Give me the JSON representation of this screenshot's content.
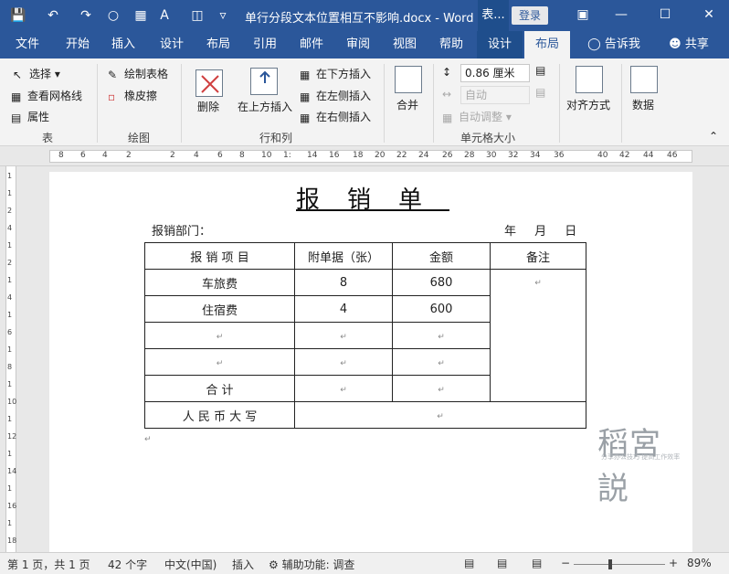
{
  "titlebar": {
    "doc_title": "单行分段文本位置相互不影响.docx - Word",
    "context_tab": "表...",
    "login": "登录"
  },
  "tabs": [
    {
      "label": "文件"
    },
    {
      "label": "开始"
    },
    {
      "label": "插入"
    },
    {
      "label": "设计"
    },
    {
      "label": "布局"
    },
    {
      "label": "引用"
    },
    {
      "label": "邮件"
    },
    {
      "label": "审阅"
    },
    {
      "label": "视图"
    },
    {
      "label": "帮助"
    },
    {
      "label": "设计"
    },
    {
      "label": "布局"
    },
    {
      "label": "告诉我"
    },
    {
      "label": "共享"
    }
  ],
  "ribbon": {
    "table_group": {
      "select": "选择",
      "gridlines": "查看网格线",
      "properties": "属性",
      "label": "表"
    },
    "draw_group": {
      "draw_table": "绘制表格",
      "eraser": "橡皮擦",
      "label": "绘图"
    },
    "rows_group": {
      "delete": "删除",
      "insert_above": "在上方插入",
      "insert_below": "在下方插入",
      "insert_left": "在左侧插入",
      "insert_right": "在右侧插入",
      "label": "行和列"
    },
    "merge_group": {
      "merge": "合并"
    },
    "cellsize_group": {
      "height": "0.86 厘米",
      "width": "自动",
      "autofit": "自动调整",
      "label": "单元格大小"
    },
    "align_group": {
      "align": "对齐方式"
    },
    "data_group": {
      "data": "数据"
    }
  },
  "ruler": {
    "numbers": [
      "8",
      "6",
      "4",
      "2",
      "2",
      "4",
      "6",
      "8",
      "10",
      "1:",
      "14",
      "16",
      "18",
      "20",
      "22",
      "24",
      "26",
      "28",
      "30",
      "32",
      "34",
      "36",
      "40",
      "42",
      "44",
      "46"
    ]
  },
  "vruler": {
    "numbers": [
      "1",
      "1",
      "2",
      "4",
      "1",
      "2",
      "1",
      "4",
      "1",
      "6",
      "1",
      "8",
      "1",
      "10",
      "1",
      "12",
      "1",
      "14",
      "1",
      "16",
      "1",
      "18"
    ]
  },
  "document": {
    "title": "报销单",
    "dept_label": "报销部门：",
    "date_label": "年 月 日",
    "table": {
      "headers": [
        "报 销 项 目",
        "附单据（张）",
        "金额",
        "备注"
      ],
      "rows": [
        [
          "车旅费",
          "8",
          "680"
        ],
        [
          "住宿费",
          "4",
          "600"
        ],
        [
          "",
          "",
          ""
        ],
        [
          "",
          "",
          ""
        ],
        [
          "合 计",
          "",
          ""
        ]
      ],
      "total_label": "人 民 币 大 写"
    },
    "para_mark": "↵"
  },
  "watermark": {
    "logo": "稻宮説",
    "tagline": "分享办公技巧 提高工作效率"
  },
  "status": {
    "page": "第 1 页，共 1 页",
    "words": "42 个字",
    "lang": "中文(中国)",
    "mode": "插入",
    "accessibility": "辅助功能: 调查",
    "zoom": "89%"
  }
}
